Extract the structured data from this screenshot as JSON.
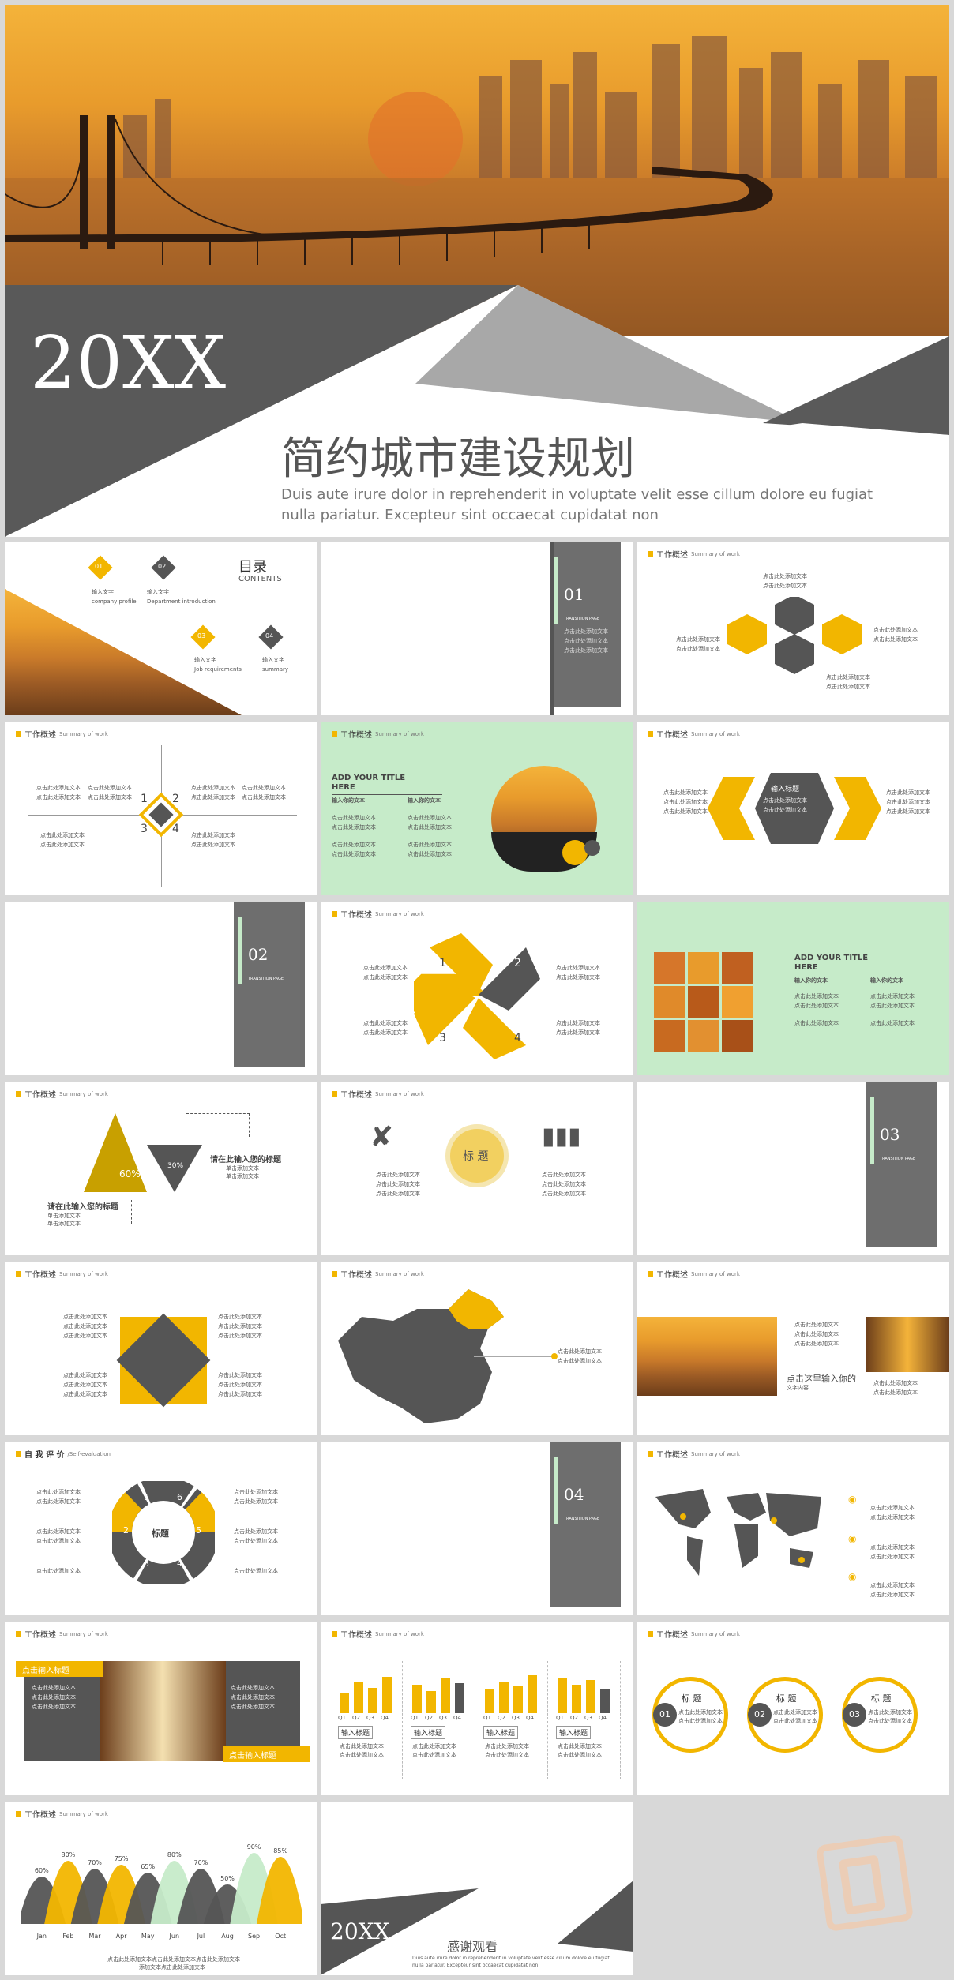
{
  "hero": {
    "year": "20XX",
    "title": "简约城市建设规划",
    "subtitle_line1": "Duis aute irure dolor in reprehenderit in voluptate velit esse cillum dolore eu fugiat",
    "subtitle_line2": "nulla pariatur. Excepteur sint occaecat cupidatat non"
  },
  "header": {
    "label": "工作概述",
    "sub": "Summary of work"
  },
  "self_header": {
    "label": "自 我 评 价",
    "sub": "/Self-evaluation"
  },
  "placeholder": "点击此处添加文本",
  "toc": {
    "title": "目录",
    "title_en": "CONTENTS",
    "items": [
      {
        "num": "01",
        "label": "输入文字",
        "sub": "company profile"
      },
      {
        "num": "02",
        "label": "输入文字",
        "sub": "Department introduction"
      },
      {
        "num": "03",
        "label": "输入文字",
        "sub": "Job requirements"
      },
      {
        "num": "04",
        "label": "输入文字",
        "sub": "summary"
      }
    ]
  },
  "sections": {
    "s1": "01",
    "s2": "02",
    "s3": "03",
    "s4": "04",
    "page_label": "TRANSITION PAGE"
  },
  "cross": {
    "nums": [
      "1",
      "2",
      "3",
      "4"
    ]
  },
  "add_title": {
    "title": "ADD YOUR TITLE",
    "title2": "HERE",
    "col1": "输入你的文本",
    "col2": "输入你的文本"
  },
  "hex_title": "输入标题",
  "petals": [
    "1",
    "2",
    "3",
    "4"
  ],
  "triangle": {
    "pct1": "60%",
    "pct2": "30%",
    "title1": "请在此输入您的标题",
    "title2": "请在此输入您的标题",
    "line": "单击添加文本"
  },
  "tools": {
    "center": "标 题"
  },
  "photos": {
    "title": "点击这里输入你的",
    "sub": "文字内容"
  },
  "ring": {
    "center": "标题",
    "nums": [
      "1",
      "6",
      "2",
      "5",
      "3",
      "4"
    ]
  },
  "banner": {
    "label1": "点击输入标题",
    "label2": "点击输入标题"
  },
  "bars": {
    "quarters": [
      "Q1",
      "Q2",
      "Q3",
      "Q4"
    ],
    "label": "输入标题"
  },
  "circles": {
    "title": "标 题",
    "nums": [
      "01",
      "02",
      "03"
    ]
  },
  "chart_data": {
    "type": "area",
    "categories": [
      "Jan",
      "Feb",
      "Mar",
      "Apr",
      "May",
      "Jun",
      "Jul",
      "Aug",
      "Sep",
      "Oct"
    ],
    "values": [
      60,
      80,
      70,
      75,
      65,
      80,
      70,
      50,
      90,
      85
    ],
    "labels": [
      "60%",
      "80%",
      "70%",
      "75%",
      "65%",
      "80%",
      "70%",
      "50%",
      "90%",
      "85%"
    ],
    "caption1": "点击此处添加文本点击此处添加文本点击此处添加文本",
    "caption2": "添加文本点击此处添加文本"
  },
  "end": {
    "year": "20XX",
    "title": "感谢观看",
    "sub1": "Duis aute irure dolor in reprehenderit in voluptate velit esse cillum dolore eu fugiat",
    "sub2": "nulla pariatur. Excepteur sint occaecat cupidatat non"
  },
  "colors": {
    "yellow": "#f2b600",
    "gray": "#555555",
    "mint": "#c6ebc9"
  }
}
